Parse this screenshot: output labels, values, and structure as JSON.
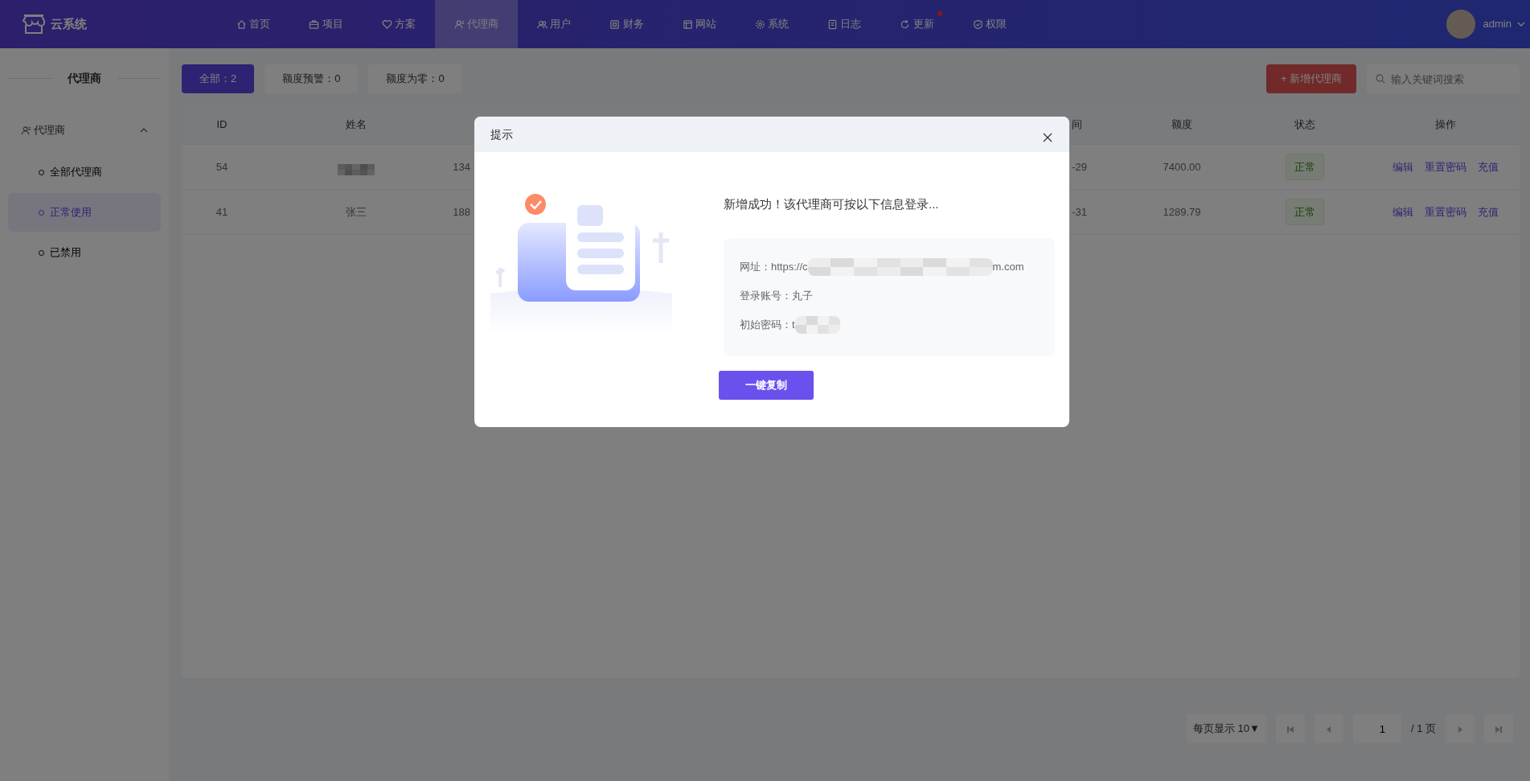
{
  "app": {
    "title": "云系统"
  },
  "nav": [
    {
      "label": "首页",
      "selected": false,
      "dot": false
    },
    {
      "label": "项目",
      "selected": false,
      "dot": false
    },
    {
      "label": "方案",
      "selected": false,
      "dot": false
    },
    {
      "label": "代理商",
      "selected": true,
      "dot": false
    },
    {
      "label": "用户",
      "selected": false,
      "dot": false
    },
    {
      "label": "财务",
      "selected": false,
      "dot": false
    },
    {
      "label": "网站",
      "selected": false,
      "dot": false
    },
    {
      "label": "系统",
      "selected": false,
      "dot": false
    },
    {
      "label": "日志",
      "selected": false,
      "dot": false
    },
    {
      "label": "更新",
      "selected": false,
      "dot": true
    },
    {
      "label": "权限",
      "selected": false,
      "dot": false
    }
  ],
  "user": {
    "name": "admin"
  },
  "sidebar": {
    "title": "代理商",
    "groups": [
      {
        "label": "代理商",
        "expanded": true,
        "children": [
          {
            "label": "全部代理商",
            "selected": false
          },
          {
            "label": "正常使用",
            "selected": true
          },
          {
            "label": "已禁用",
            "selected": false
          }
        ]
      }
    ]
  },
  "filters": [
    {
      "label": "全部：2",
      "selected": true
    },
    {
      "label": "额度预警：0",
      "selected": false
    },
    {
      "label": "额度为零：0",
      "selected": false
    }
  ],
  "add_button": "+ 新增代理商",
  "search": {
    "placeholder": "输入关键词搜索"
  },
  "table": {
    "columns": {
      "id": "ID",
      "name": "姓名",
      "column_4": "间",
      "quota": "额度",
      "status": "状态",
      "actions": "操作"
    },
    "rows": [
      {
        "id": "54",
        "name_redacted": true,
        "column_3": "134",
        "column_4": "-29",
        "quota": "7400.00",
        "status": "正常",
        "actions": [
          "编辑",
          "重置密码",
          "充值"
        ]
      },
      {
        "id": "41",
        "name": "张三",
        "name_redacted": false,
        "column_3": "188",
        "column_4": "-31",
        "quota": "1289.79",
        "status": "正常",
        "actions": [
          "编辑",
          "重置密码",
          "充值"
        ]
      }
    ]
  },
  "pagination": {
    "page_size": "每页显示 10▼",
    "page": "1",
    "total": "/ 1 页",
    "buttons": [
      {
        "kind": "first",
        "disabled": true
      },
      {
        "kind": "prev",
        "disabled": true
      },
      {
        "kind": "next",
        "disabled": true
      },
      {
        "kind": "last",
        "disabled": true
      }
    ]
  },
  "dialog": {
    "title": "提示",
    "message": "新增成功！该代理商可按以下信息登录...",
    "info": [
      {
        "label": "网址：https://c",
        "redacted": true,
        "tail": "m.com"
      },
      {
        "label": "登录账号：丸子",
        "redacted": false
      },
      {
        "label": "初始密码：t",
        "redacted": true
      }
    ],
    "button": "一键复制"
  }
}
